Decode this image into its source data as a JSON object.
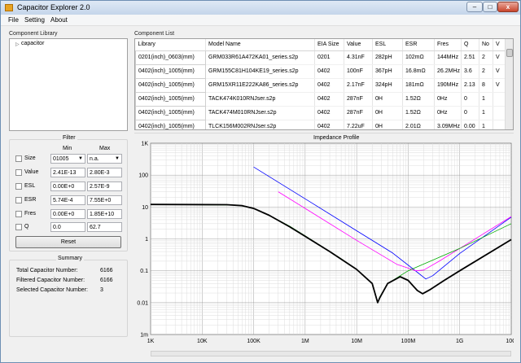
{
  "window": {
    "title": "Capacitor Explorer 2.0",
    "controls": [
      {
        "name": "minimize-button",
        "label": "‒"
      },
      {
        "name": "maximize-button",
        "label": "□"
      },
      {
        "name": "close-button",
        "label": "x"
      }
    ]
  },
  "menu": [
    {
      "name": "menu-file",
      "label": "File"
    },
    {
      "name": "menu-setting",
      "label": "Setting"
    },
    {
      "name": "menu-about",
      "label": "About"
    }
  ],
  "library": {
    "title": "Component Library",
    "items": [
      {
        "label": "capacitor",
        "expanded": false
      }
    ]
  },
  "filter": {
    "title": "Filter",
    "min_header": "Min",
    "max_header": "Max",
    "rows": [
      {
        "name": "size",
        "label": "Size",
        "min": "01005",
        "max": "n.a.",
        "dropdown": true
      },
      {
        "name": "value",
        "label": "Value",
        "min": "2.41E-13",
        "max": "2.80E-3",
        "dropdown": false
      },
      {
        "name": "esl",
        "label": "ESL",
        "min": "0.00E+0",
        "max": "2.57E-9",
        "dropdown": false
      },
      {
        "name": "esr",
        "label": "ESR",
        "min": "5.74E-4",
        "max": "7.55E+0",
        "dropdown": false
      },
      {
        "name": "fres",
        "label": "Fres",
        "min": "0.00E+0",
        "max": "1.85E+10",
        "dropdown": false
      },
      {
        "name": "q",
        "label": "Q",
        "min": "0.0",
        "max": "62.7",
        "dropdown": false
      }
    ],
    "reset_label": "Reset"
  },
  "summary": {
    "title": "Summary",
    "rows": [
      {
        "label": "Total Capacitor Number:",
        "value": "6166"
      },
      {
        "label": "Filtered Capacitor Number:",
        "value": "6166"
      },
      {
        "label": "Selected Capacitor Number:",
        "value": "3"
      }
    ]
  },
  "component_list": {
    "title": "Component List",
    "columns": [
      "Library",
      "Model Name",
      "EIA Size",
      "Value",
      "ESL",
      "ESR",
      "Fres",
      "Q",
      "No",
      "V"
    ],
    "rows": [
      [
        "0201(inch)_0603(mm)",
        "GRM033R61A472KA01_series.s2p",
        "0201",
        "4.31nF",
        "282pH",
        "102mΩ",
        "144MHz",
        "2.51",
        "2",
        "V"
      ],
      [
        "0402(inch)_1005(mm)",
        "GRM155C81H104KE19_series.s2p",
        "0402",
        "100nF",
        "367pH",
        "16.8mΩ",
        "26.2MHz",
        "3.6",
        "2",
        "V"
      ],
      [
        "0402(inch)_1005(mm)",
        "GRM15XR11E222KA86_series.s2p",
        "0402",
        "2.17nF",
        "324pH",
        "181mΩ",
        "190MHz",
        "2.13",
        "8",
        "V"
      ],
      [
        "0402(inch)_1005(mm)",
        "TACK474K010RNJser.s2p",
        "0402",
        "287nF",
        "0H",
        "1.52Ω",
        "0Hz",
        "0",
        "1",
        ""
      ],
      [
        "0402(inch)_1005(mm)",
        "TACK474M010RNJser.s2p",
        "0402",
        "287nF",
        "0H",
        "1.52Ω",
        "0Hz",
        "0",
        "1",
        ""
      ],
      [
        "0402(inch)_1005(mm)",
        "TLCK156M002RNJser.s2p",
        "0402",
        "7.22uF",
        "0H",
        "2.01Ω",
        "3.09MHz",
        "0.00",
        "1",
        ""
      ]
    ]
  },
  "chart_data": {
    "type": "line",
    "title": "Impedance Profile",
    "xscale": "log",
    "yscale": "log",
    "xlim": [
      1000,
      10000000000
    ],
    "ylim": [
      0.001,
      1000
    ],
    "grid": true,
    "legend": "none",
    "x_ticks": [
      {
        "value": 1000,
        "label": "1K"
      },
      {
        "value": 10000,
        "label": "10K"
      },
      {
        "value": 100000,
        "label": "100K"
      },
      {
        "value": 1000000,
        "label": "1M"
      },
      {
        "value": 10000000,
        "label": "10M"
      },
      {
        "value": 100000000,
        "label": "100M"
      },
      {
        "value": 1000000000,
        "label": "1G"
      },
      {
        "value": 10000000000,
        "label": "10G"
      }
    ],
    "y_ticks": [
      {
        "value": 1000,
        "label": "1K"
      },
      {
        "value": 100,
        "label": "100"
      },
      {
        "value": 10,
        "label": "10"
      },
      {
        "value": 1,
        "label": "1"
      },
      {
        "value": 0.1,
        "label": "0.1"
      },
      {
        "value": 0.01,
        "label": "0.01"
      },
      {
        "value": 0.001,
        "label": "1m"
      }
    ],
    "series": [
      {
        "color": "#0000ff",
        "width": 0.8,
        "points": [
          [
            100000,
            180
          ],
          [
            1000000,
            18
          ],
          [
            10000000,
            1.8
          ],
          [
            50000000,
            0.36
          ],
          [
            150000000,
            0.09
          ],
          [
            220000000,
            0.055
          ],
          [
            300000000,
            0.07
          ],
          [
            1000000000,
            0.35
          ],
          [
            10000000000,
            4.8
          ]
        ]
      },
      {
        "color": "#ff00ff",
        "width": 0.8,
        "points": [
          [
            300000,
            30
          ],
          [
            1000000,
            9
          ],
          [
            10000000,
            0.9
          ],
          [
            60000000,
            0.16
          ],
          [
            110000000,
            0.115
          ],
          [
            140000000,
            0.1
          ],
          [
            200000000,
            0.105
          ],
          [
            400000000,
            0.2
          ],
          [
            1000000000,
            0.5
          ],
          [
            10000000000,
            5
          ]
        ]
      },
      {
        "color": "#00aa00",
        "width": 0.8,
        "points": [
          [
            1000,
            12
          ],
          [
            50000,
            11.5
          ],
          [
            100000,
            9
          ],
          [
            200000,
            5.5
          ],
          [
            500000,
            2.5
          ],
          [
            1000000,
            1.25
          ],
          [
            5000000,
            0.24
          ],
          [
            10000000,
            0.11
          ],
          [
            20000000,
            0.04
          ],
          [
            25000000,
            0.012
          ],
          [
            26000000,
            0.01
          ],
          [
            28000000,
            0.015
          ],
          [
            40000000,
            0.04
          ],
          [
            100000000,
            0.1
          ],
          [
            1000000000,
            0.5
          ],
          [
            10000000000,
            3
          ]
        ]
      },
      {
        "color": "#000000",
        "width": 1.8,
        "points": [
          [
            1000,
            12
          ],
          [
            30000,
            11.8
          ],
          [
            60000,
            11
          ],
          [
            100000,
            9
          ],
          [
            200000,
            5.5
          ],
          [
            500000,
            2.4
          ],
          [
            1000000,
            1.2
          ],
          [
            3000000,
            0.4
          ],
          [
            10000000,
            0.11
          ],
          [
            20000000,
            0.04
          ],
          [
            25500000,
            0.01
          ],
          [
            28000000,
            0.014
          ],
          [
            40000000,
            0.04
          ],
          [
            70000000,
            0.065
          ],
          [
            100000000,
            0.05
          ],
          [
            150000000,
            0.024
          ],
          [
            190000000,
            0.019
          ],
          [
            260000000,
            0.025
          ],
          [
            500000000,
            0.05
          ],
          [
            1000000000,
            0.1
          ],
          [
            10000000000,
            0.95
          ]
        ]
      }
    ]
  }
}
